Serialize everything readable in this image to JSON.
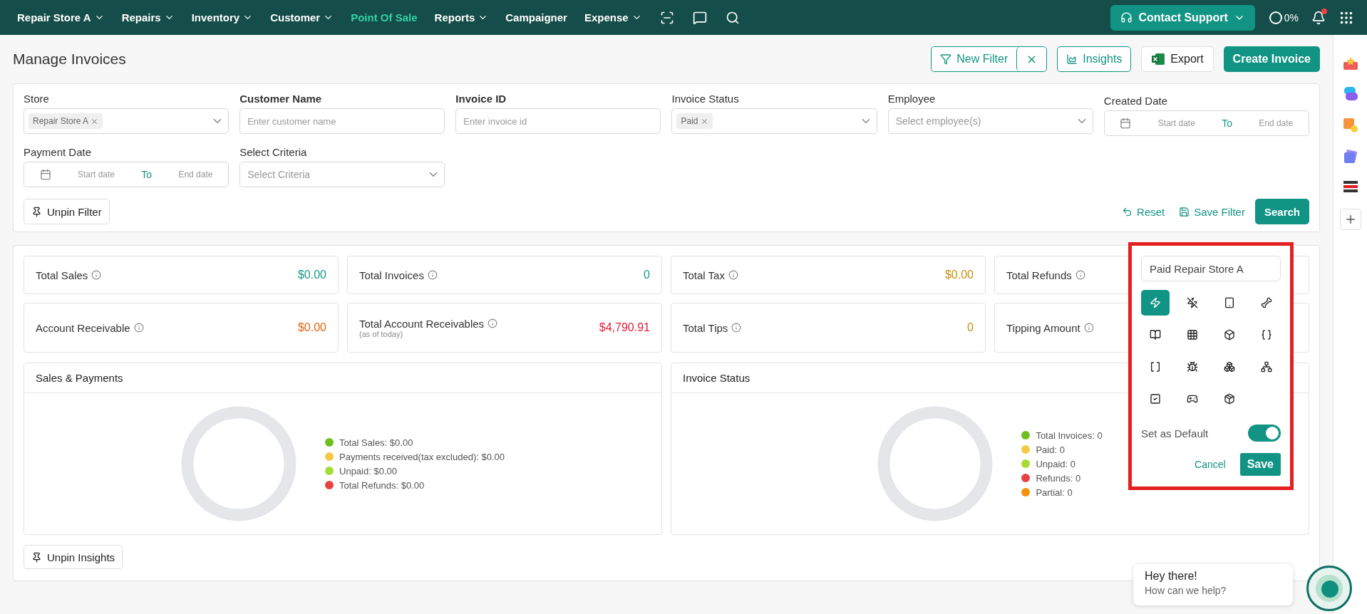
{
  "nav": {
    "items": [
      {
        "label": "Repair Store A",
        "selected": false,
        "dropdown": true
      },
      {
        "label": "Repairs",
        "selected": false,
        "dropdown": true
      },
      {
        "label": "Inventory",
        "selected": false,
        "dropdown": true
      },
      {
        "label": "Customer",
        "selected": false,
        "dropdown": true
      },
      {
        "label": "Point Of Sale",
        "selected": true,
        "dropdown": false
      },
      {
        "label": "Reports",
        "selected": false,
        "dropdown": true
      },
      {
        "label": "Campaigner",
        "selected": false,
        "dropdown": false
      },
      {
        "label": "Expense",
        "selected": false,
        "dropdown": true
      }
    ],
    "support": "Contact Support",
    "progress": "0%",
    "notification": true
  },
  "title": "Manage Invoices",
  "actions": {
    "new_filter": "New Filter",
    "insights": "Insights",
    "export": "Export",
    "create": "Create Invoice"
  },
  "filters": [
    {
      "kind": "select",
      "label": "Store",
      "bold": false,
      "chips": [
        "Repair Store A"
      ]
    },
    {
      "kind": "text",
      "label": "Customer Name",
      "bold": true,
      "placeholder": "Enter customer name"
    },
    {
      "kind": "text",
      "label": "Invoice ID",
      "bold": true,
      "placeholder": "Enter invoice id"
    },
    {
      "kind": "select",
      "label": "Invoice Status",
      "bold": false,
      "chips": [
        "Paid"
      ]
    },
    {
      "kind": "select",
      "label": "Employee",
      "bold": false,
      "placeholder": "Select employee(s)"
    },
    {
      "kind": "date",
      "label": "Created Date",
      "bold": false,
      "start": "Start date",
      "sep": "To",
      "end": "End date"
    },
    {
      "kind": "date",
      "label": "Payment Date",
      "bold": false,
      "start": "Start date",
      "sep": "To",
      "end": "End date"
    },
    {
      "kind": "select",
      "label": "Select Criteria",
      "bold": false,
      "placeholder": "Select Criteria"
    }
  ],
  "filter_buttons": {
    "unpin": "Unpin Filter",
    "reset": "Reset",
    "save": "Save Filter",
    "search": "Search"
  },
  "stats": [
    {
      "label": "Total Sales",
      "value": "$0.00",
      "color": "#169a8c"
    },
    {
      "label": "Total Invoices",
      "value": "0",
      "color": "#169a8c"
    },
    {
      "label": "Total Tax",
      "value": "$0.00",
      "color": "#c8900c"
    },
    {
      "label": "Total Refunds"
    },
    {
      "label": "Account Receivable",
      "value": "$0.00",
      "color": "#e5650c"
    },
    {
      "label": "Total Account Receivables",
      "note": "(as of today)",
      "value": "$4,790.91",
      "color": "#e0203c"
    },
    {
      "label": "Total Tips",
      "value": "0",
      "color": "#c8900c"
    },
    {
      "label": "Tipping Amount"
    }
  ],
  "panels": [
    {
      "title": "Sales & Payments",
      "legend": [
        {
          "label": "Total Sales: $0.00",
          "color": "#6fc01e"
        },
        {
          "label": "Payments received(tax excluded): $0.00",
          "color": "#f6c944"
        },
        {
          "label": "Unpaid: $0.00",
          "color": "#a5dc34"
        },
        {
          "label": "Total Refunds: $0.00",
          "color": "#e84343"
        }
      ]
    },
    {
      "title": "Invoice Status",
      "legend": [
        {
          "label": "Total Invoices: 0",
          "color": "#6fc01e"
        },
        {
          "label": "Paid: 0",
          "color": "#f6c944"
        },
        {
          "label": "Unpaid: 0",
          "color": "#a5dc34"
        },
        {
          "label": "Refunds: 0",
          "color": "#e84343"
        },
        {
          "label": "Partial: 0",
          "color": "#f78f0a"
        }
      ]
    }
  ],
  "unpin_insights": "Unpin Insights",
  "save_popup": {
    "name": "Paid Repair Store A",
    "icons": [
      {
        "selected": true
      },
      {
        "selected": false
      },
      {
        "selected": false
      },
      {
        "selected": false
      },
      {
        "selected": false
      },
      {
        "selected": false
      },
      {
        "selected": false
      },
      {
        "selected": false
      },
      {
        "selected": false
      },
      {
        "selected": false
      },
      {
        "selected": false
      },
      {
        "selected": false
      },
      {
        "selected": false
      },
      {
        "selected": false
      },
      {
        "selected": false
      }
    ],
    "default_label": "Set as Default",
    "default_on": true,
    "cancel": "Cancel",
    "save": "Save"
  },
  "chat": {
    "title": "Hey there!",
    "subtitle": "How can we help?"
  }
}
